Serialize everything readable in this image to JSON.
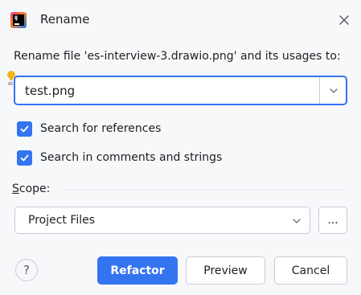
{
  "window": {
    "title": "Rename",
    "app_icon": "intellij-idea-icon",
    "close_icon": "close-icon"
  },
  "prompt": {
    "text": "Rename file 'es-interview-3.drawio.png' and its usages to:"
  },
  "name_field": {
    "value": "test.png",
    "dropdown_icon": "chevron-down-icon",
    "hint_icon": "lightbulb-icon"
  },
  "options": [
    {
      "label": "Search for references",
      "checked": true
    },
    {
      "label": "Search in comments and strings",
      "checked": true
    }
  ],
  "scope": {
    "label_mnemonic": "S",
    "label_rest": "cope:",
    "selected": "Project Files",
    "more_label": "..."
  },
  "footer": {
    "help_label": "?",
    "refactor_label": "Refactor",
    "preview_label": "Preview",
    "cancel_label": "Cancel"
  },
  "colors": {
    "accent": "#3574f0",
    "background": "#f7f8fa",
    "border": "#c9ccd6",
    "text": "#1e1f22",
    "bulb": "#f2b51e"
  }
}
